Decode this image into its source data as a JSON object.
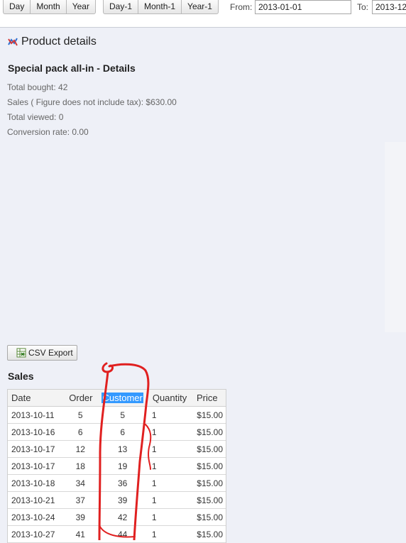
{
  "toolbar": {
    "range_buttons": [
      "Day",
      "Month",
      "Year"
    ],
    "offset_buttons": [
      "Day-1",
      "Month-1",
      "Year-1"
    ],
    "from_label": "From:",
    "from_value": "2013-01-01",
    "to_label": "To:",
    "to_value": "2013-12"
  },
  "page": {
    "heading": "Product details",
    "subtitle": "Special pack all-in - Details",
    "stats": [
      "Total bought: 42",
      "Sales ( Figure does not include tax): $630.00",
      "Total viewed: 0",
      "Conversion rate: 0.00"
    ],
    "csv_label": "CSV Export"
  },
  "sales": {
    "title": "Sales",
    "columns": [
      "Date",
      "Order",
      "Customer",
      "Quantity",
      "Price"
    ],
    "rows": [
      [
        "2013-10-11",
        "5",
        "5",
        "1",
        "$15.00"
      ],
      [
        "2013-10-16",
        "6",
        "6",
        "1",
        "$15.00"
      ],
      [
        "2013-10-17",
        "12",
        "13",
        "1",
        "$15.00"
      ],
      [
        "2013-10-17",
        "18",
        "19",
        "1",
        "$15.00"
      ],
      [
        "2013-10-18",
        "34",
        "36",
        "1",
        "$15.00"
      ],
      [
        "2013-10-21",
        "37",
        "39",
        "1",
        "$15.00"
      ],
      [
        "2013-10-24",
        "39",
        "42",
        "1",
        "$15.00"
      ],
      [
        "2013-10-27",
        "41",
        "44",
        "1",
        "$15.00"
      ]
    ]
  },
  "colors": {
    "background": "#eef0f7",
    "selection_highlight": "#3399ff",
    "annotation_red": "#e02020"
  }
}
